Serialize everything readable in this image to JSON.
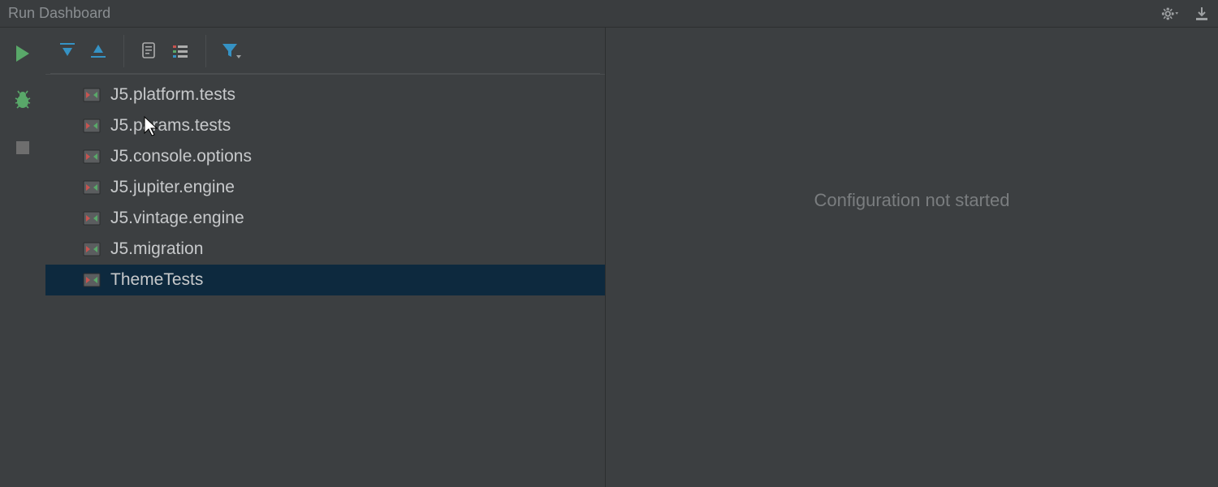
{
  "window": {
    "title": "Run Dashboard"
  },
  "tree": {
    "items": [
      {
        "label": "J5.platform.tests",
        "selected": false
      },
      {
        "label": "J5.params.tests",
        "selected": false
      },
      {
        "label": "J5.console.options",
        "selected": false
      },
      {
        "label": "J5.jupiter.engine",
        "selected": false
      },
      {
        "label": "J5.vintage.engine",
        "selected": false
      },
      {
        "label": "J5.migration",
        "selected": false
      },
      {
        "label": "ThemeTests",
        "selected": true
      }
    ]
  },
  "status": {
    "message": "Configuration not started"
  }
}
